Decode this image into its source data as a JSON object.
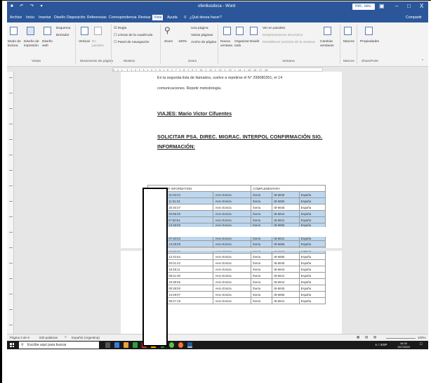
{
  "titlebar": {
    "quick_access": "■ ↶ ↷ ▾",
    "doc_title": "ofenliusdoca - Word",
    "signin": "Inic. ses.",
    "ctrl_restore": "▣",
    "ctrl_min": "–",
    "ctrl_max": "□",
    "ctrl_close": "X"
  },
  "menu": {
    "tabs": [
      "Archivo",
      "Inicio",
      "Insertar",
      "Diseño",
      "Disposición",
      "Referencias",
      "Correspondencia",
      "Revisar",
      "Vista",
      "Ayuda"
    ],
    "tell_me": "¿Qué desea hacer?",
    "share": "Compartir"
  },
  "ribbon": {
    "views": {
      "read": "Modo de lectura",
      "print": "Diseño de impresión",
      "web": "Diseño web",
      "outline": "Esquema",
      "draft": "Borrador",
      "group": "Vistas"
    },
    "page_move": {
      "vertical": "Vertical",
      "side": "En paralelo",
      "group": "Movimiento de página"
    },
    "show": {
      "ruler": "Regla",
      "gridlines": "Líneas de la cuadrícula",
      "nav": "Panel de navegación",
      "group": "Mostrar"
    },
    "zoom": {
      "zoom": "Zoom",
      "pct": "100%",
      "one": "Una página",
      "multi": "Varias páginas",
      "width": "Ancho de página",
      "group": "Zoom"
    },
    "window": {
      "new": "Nueva ventana",
      "arrange": "Organizar todo",
      "split": "Dividir",
      "side": "Ver en paralelo",
      "sync": "Desplazamiento sincrónico",
      "reset": "Restablecer posición de la ventana",
      "switch": "Cambiar ventanas",
      "group": "Ventana"
    },
    "macros": {
      "label": "Macros",
      "group": "Macros"
    },
    "sharepoint": {
      "label": "Propiedades",
      "group": "SharePoint"
    }
  },
  "ruler_text": "2 · 1 · 1 ·   1 · 1 · 2 · 1 · 3 · 1 · 4 · 1 · 5 · 1 · 6 · 1 · 7 · 1 · 8 · 1 · 9 · 1 · 10 · 1 · 11 · 1 · 12 · 1 · 13 · 1 · 14 · 1 · 15 · 16 · 17 · 18",
  "document": {
    "para1": "En la segunda lista de llamados, vuelve a repetirse el N° 299080351, el 14",
    "para2": "comunicaciones. Repetir metodología.",
    "heading1": "VIAJES: Mario Victor Cifuentes",
    "heading2a": "SOLICITAR   PSA.   DIREC.   MIGRAC.   INTERPOL   CONFIRMACIÓN   SIG.",
    "heading2b": "INFORMACIÓN:",
    "table_head": [
      "BASIC FLIGHT INFORMATION",
      "COMPLEMENTARY"
    ],
    "rows": [
      [
        "E 03-02-2018 21:03:24",
        "Aero Ezeiza",
        "Iberia",
        "IB-6845",
        "España",
        true
      ],
      [
        "S 09-01-2018 11:31:34",
        "Aero Ezeiza",
        "Iberia",
        "IB-6856",
        "España",
        true
      ],
      [
        "E 30-08-2017 20:40:37",
        "Aero Ezeiza",
        "Iberia",
        "IB-6845",
        "España",
        false
      ],
      [
        "S 26-12-2016 20:59:25",
        "Aero Ezeiza",
        "Iberia",
        "IB-6844",
        "España",
        true
      ],
      [
        "E 11-07-2016 07:50:54",
        "Aero Ezeiza",
        "Iberia",
        "IB-6841",
        "España",
        true
      ],
      [
        "S 03-07-2016 13:48:05",
        "Aero Ezeiza",
        "Iberia",
        "IB-6856",
        "España",
        true
      ],
      [
        "E 21-06-2016 07:40:03",
        "Aero Ezeiza",
        "Iberia",
        "IB-6841",
        "España",
        true
      ],
      [
        "S 16-06-2016 13:28:09",
        "Aero Ezeiza",
        "Iberia",
        "IB-6856",
        "España",
        true
      ],
      [
        "E 16-01-2016 09:12:55",
        "Aero Ezeiza",
        "Iberia",
        "IB-6841",
        "España",
        true
      ],
      [
        "S 18-12-2015 12:42:54",
        "Aero Ezeiza",
        "Iberia",
        "IB-6856",
        "España",
        false
      ],
      [
        "E 08-06-2015 20:01:42",
        "Aero Ezeiza",
        "Iberia",
        "IB-6845",
        "España",
        false
      ],
      [
        "S 23-05-2015 19:48:11",
        "Aero Ezeiza",
        "Iberia",
        "IB-6844",
        "España",
        false
      ],
      [
        "E 12-05-2015 08:41:30",
        "Aero Ezeiza",
        "Iberia",
        "IB-6841",
        "España",
        false
      ],
      [
        "S 04-05-2015 19:35:55",
        "Aero Ezeiza",
        "Iberia",
        "IB-6844",
        "España",
        false
      ],
      [
        "E 17-03-2015 00:28:00",
        "Aero Ezeiza",
        "Iberia",
        "IB-6845",
        "España",
        false
      ],
      [
        "S 06-03-2015 13:49:07",
        "Aero Ezeiza",
        "Iberia",
        "IB-6856",
        "España",
        false
      ],
      [
        "E 16-03-2015 08:47:19",
        "Aero Ezeiza",
        "Iberia",
        "IB-6841",
        "España",
        false
      ]
    ]
  },
  "status": {
    "page": "Página 3 de 9",
    "words": "830 palabras",
    "lang": "Español (Argentina)",
    "zoom": "100%"
  },
  "taskbar": {
    "search": "Escribe aquí para buscar",
    "time": "16:20",
    "date": "15/7/2020",
    "tray": "∧  □  ESP"
  },
  "colors": {
    "word_blue": "#2b579a",
    "row_highlight": "#bdd7ee",
    "taskbar": "#1a1a1a"
  }
}
